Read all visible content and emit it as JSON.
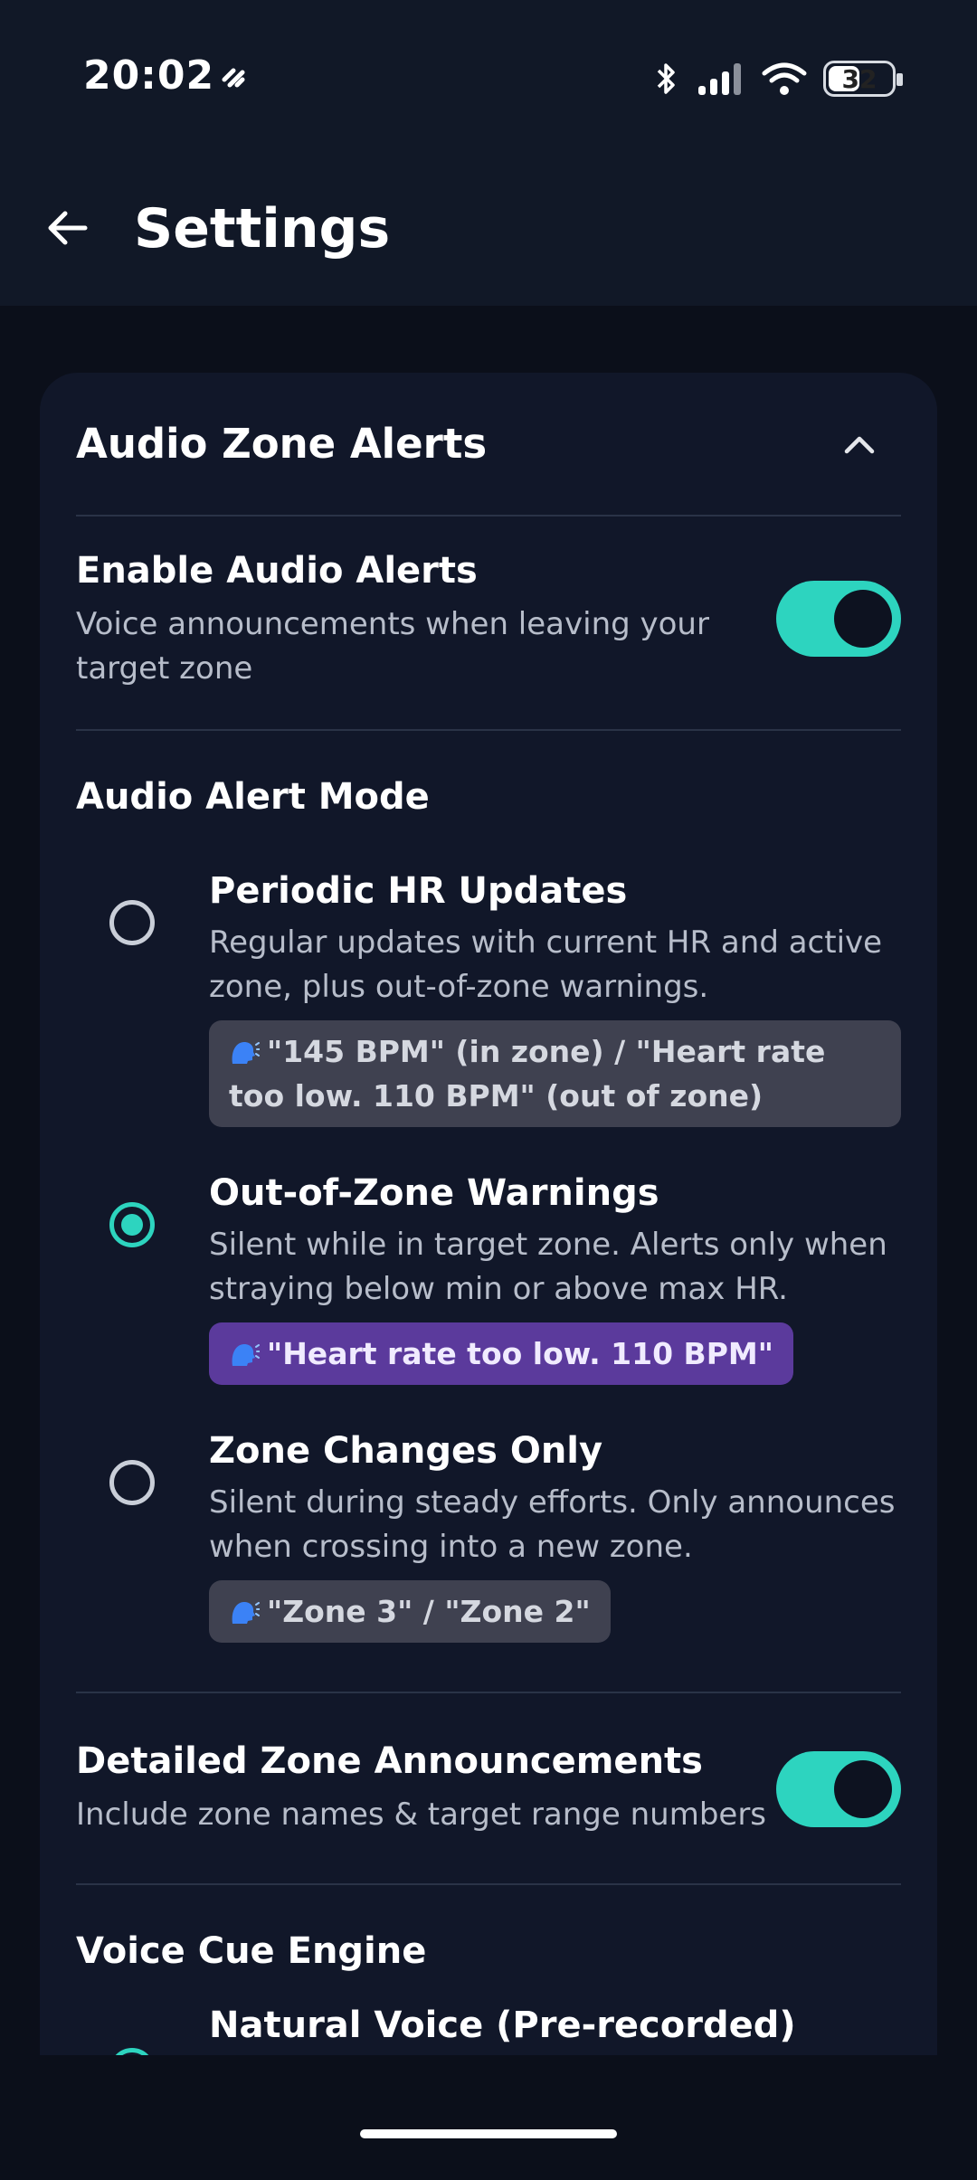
{
  "status_bar": {
    "time": "20:02",
    "battery": "32"
  },
  "app_bar": {
    "title": "Settings"
  },
  "section": {
    "title": "Audio Zone Alerts",
    "enable_alerts": {
      "title": "Enable Audio Alerts",
      "subtitle": "Voice announcements when leaving your target zone",
      "enabled": true
    },
    "mode": {
      "label": "Audio Alert Mode",
      "options": [
        {
          "title": "Periodic HR Updates",
          "subtitle": "Regular updates with current HR and active zone, plus out-of-zone warnings.",
          "example": "\"145 BPM\" (in zone) / \"Heart rate too low. 110 BPM\" (out of zone)",
          "selected": false
        },
        {
          "title": "Out-of-Zone Warnings",
          "subtitle": "Silent while in target zone. Alerts only when straying below min or above max HR.",
          "example": "\"Heart rate too low. 110 BPM\"",
          "selected": true
        },
        {
          "title": "Zone Changes Only",
          "subtitle": "Silent during steady efforts. Only announces when crossing into a new zone.",
          "example": "\"Zone 3\" / \"Zone 2\"",
          "selected": false
        }
      ]
    },
    "detailed": {
      "title": "Detailed Zone Announcements",
      "subtitle": "Include zone names & target range numbers",
      "enabled": true
    },
    "voice_engine": {
      "label": "Voice Cue Engine",
      "options": [
        {
          "title": "Natural Voice (Pre-recorded)",
          "selected": true
        }
      ]
    }
  },
  "colors": {
    "accent": "#2dd4bf",
    "background": "#0b0f1a",
    "card": "#111729",
    "selected_chip": "#5b3a9c"
  }
}
